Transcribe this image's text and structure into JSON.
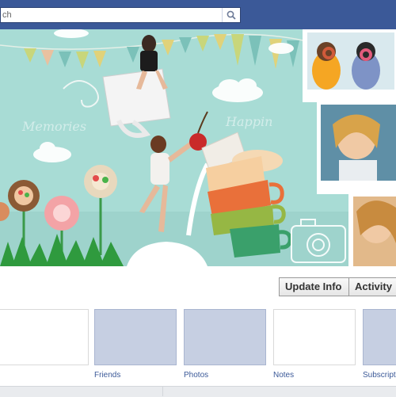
{
  "search": {
    "value": "ch"
  },
  "cover": {
    "word_left": "Memories",
    "word_right": "Happin"
  },
  "profile_actions": {
    "update_info": "Update Info",
    "activity": "Activity"
  },
  "apps": [
    {
      "label": ""
    },
    {
      "label": "Friends"
    },
    {
      "label": "Photos"
    },
    {
      "label": "Notes"
    },
    {
      "label": "Subscript"
    }
  ],
  "colors": {
    "facebook_blue": "#3b5998",
    "cover_teal": "#a9dcd7",
    "tile_blue": "#c6cfe2"
  }
}
